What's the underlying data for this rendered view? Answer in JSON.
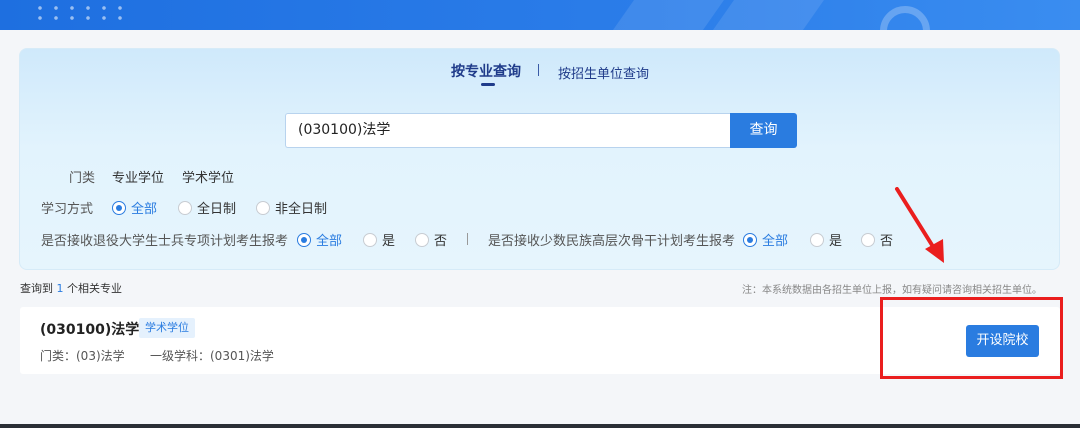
{
  "tabs": {
    "by_major": "按专业查询",
    "by_unit": "按招生单位查询"
  },
  "search": {
    "value": "(030100)法学",
    "button": "查询"
  },
  "filters": {
    "category": {
      "label": "门类",
      "items": [
        "专业学位",
        "学术学位"
      ]
    },
    "study_mode": {
      "label": "学习方式",
      "options": [
        "全部",
        "全日制",
        "非全日制"
      ],
      "selected": "全部"
    },
    "veteran_plan": {
      "label": "是否接收退役大学生士兵专项计划考生报考",
      "options": [
        "全部",
        "是",
        "否"
      ],
      "selected": "全部"
    },
    "minority_plan": {
      "label": "是否接收少数民族高层次骨干计划考生报考",
      "options": [
        "全部",
        "是",
        "否"
      ],
      "selected": "全部"
    }
  },
  "results": {
    "count_prefix": "查询到",
    "count": "1",
    "count_suffix": "个相关专业",
    "note": "注：本系统数据由各招生单位上报，如有疑问请咨询相关招生单位。",
    "items": [
      {
        "name": "(030100)法学",
        "tag": "学术学位",
        "category": "门类：(03)法学",
        "discipline": "一级学科：(0301)法学",
        "action": "开设院校"
      }
    ]
  },
  "colors": {
    "accent": "#2a7ce0",
    "annotation": "#ea1e1e",
    "banner": "#2b7de9"
  }
}
